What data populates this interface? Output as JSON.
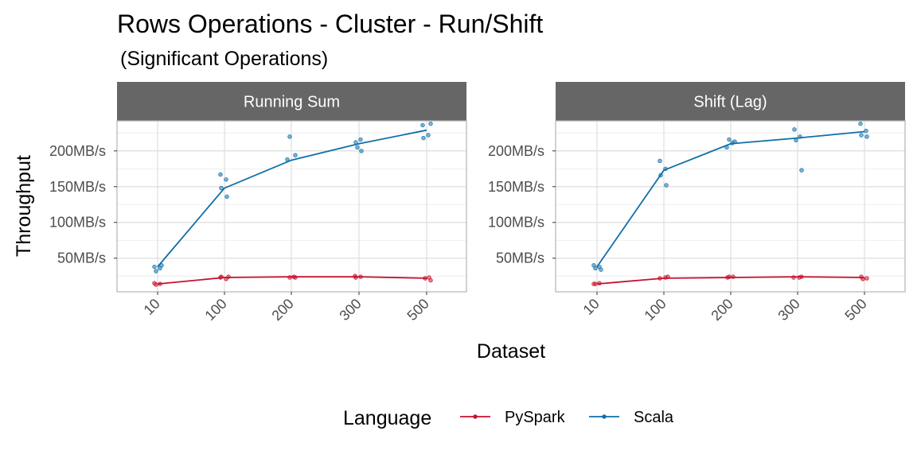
{
  "chart_data": {
    "type": "line",
    "title": "Rows Operations - Cluster - Run/Shift",
    "subtitle": " (Significant Operations)",
    "xlabel": "Dataset",
    "ylabel": "Throughput",
    "x_ticks": [
      "10",
      "100",
      "200",
      "300",
      "500"
    ],
    "y_ticks": [
      50,
      100,
      150,
      200
    ],
    "y_tick_labels": [
      "50MB/s",
      "100MB/s",
      "150MB/s",
      "200MB/s"
    ],
    "ylim": [
      3,
      242
    ],
    "grid": true,
    "legend": {
      "title": "Language",
      "position": "bottom",
      "entries": [
        "PySpark",
        "Scala"
      ]
    },
    "colors": {
      "PySpark": "#c8102e",
      "Scala": "#0f6fa8"
    },
    "panels": [
      {
        "facet": "Running Sum",
        "series": [
          {
            "name": "PySpark",
            "values": [
              14,
              23,
              24,
              24,
              22
            ],
            "points": [
              [
                0,
                15
              ],
              [
                0,
                14
              ],
              [
                0,
                13
              ],
              [
                1,
                24
              ],
              [
                1,
                23
              ],
              [
                1,
                21
              ],
              [
                1,
                24
              ],
              [
                2,
                24
              ],
              [
                2,
                23
              ],
              [
                2,
                23
              ],
              [
                3,
                25
              ],
              [
                3,
                24
              ],
              [
                3,
                23
              ],
              [
                4,
                23
              ],
              [
                4,
                22
              ],
              [
                4,
                19
              ]
            ]
          },
          {
            "name": "Scala",
            "values": [
              38,
              148,
              187,
              210,
              229
            ],
            "points": [
              [
                0,
                38
              ],
              [
                0,
                36
              ],
              [
                0,
                32
              ],
              [
                0,
                40
              ],
              [
                1,
                167
              ],
              [
                1,
                160
              ],
              [
                1,
                148
              ],
              [
                1,
                136
              ],
              [
                2,
                220
              ],
              [
                2,
                194
              ],
              [
                2,
                188
              ],
              [
                3,
                216
              ],
              [
                3,
                212
              ],
              [
                3,
                200
              ],
              [
                3,
                205
              ],
              [
                4,
                238
              ],
              [
                4,
                236
              ],
              [
                4,
                222
              ],
              [
                4,
                218
              ]
            ]
          }
        ]
      },
      {
        "facet": "Shift (Lag)",
        "series": [
          {
            "name": "PySpark",
            "values": [
              14,
              22,
              23,
              24,
              23
            ],
            "points": [
              [
                0,
                14
              ],
              [
                0,
                15
              ],
              [
                0,
                14
              ],
              [
                1,
                24
              ],
              [
                1,
                22
              ],
              [
                1,
                23
              ],
              [
                2,
                23
              ],
              [
                2,
                24
              ],
              [
                2,
                24
              ],
              [
                3,
                24
              ],
              [
                3,
                23
              ],
              [
                3,
                23
              ],
              [
                4,
                24
              ],
              [
                4,
                22
              ],
              [
                4,
                21
              ]
            ]
          },
          {
            "name": "Scala",
            "values": [
              38,
              173,
              210,
              218,
              227
            ],
            "points": [
              [
                0,
                40
              ],
              [
                0,
                38
              ],
              [
                0,
                36
              ],
              [
                0,
                34
              ],
              [
                1,
                186
              ],
              [
                1,
                175
              ],
              [
                1,
                166
              ],
              [
                1,
                152
              ],
              [
                2,
                216
              ],
              [
                2,
                213
              ],
              [
                2,
                205
              ],
              [
                2,
                211
              ],
              [
                3,
                230
              ],
              [
                3,
                220
              ],
              [
                3,
                215
              ],
              [
                3,
                173
              ],
              [
                4,
                238
              ],
              [
                4,
                228
              ],
              [
                4,
                222
              ],
              [
                4,
                220
              ]
            ]
          }
        ]
      }
    ]
  }
}
